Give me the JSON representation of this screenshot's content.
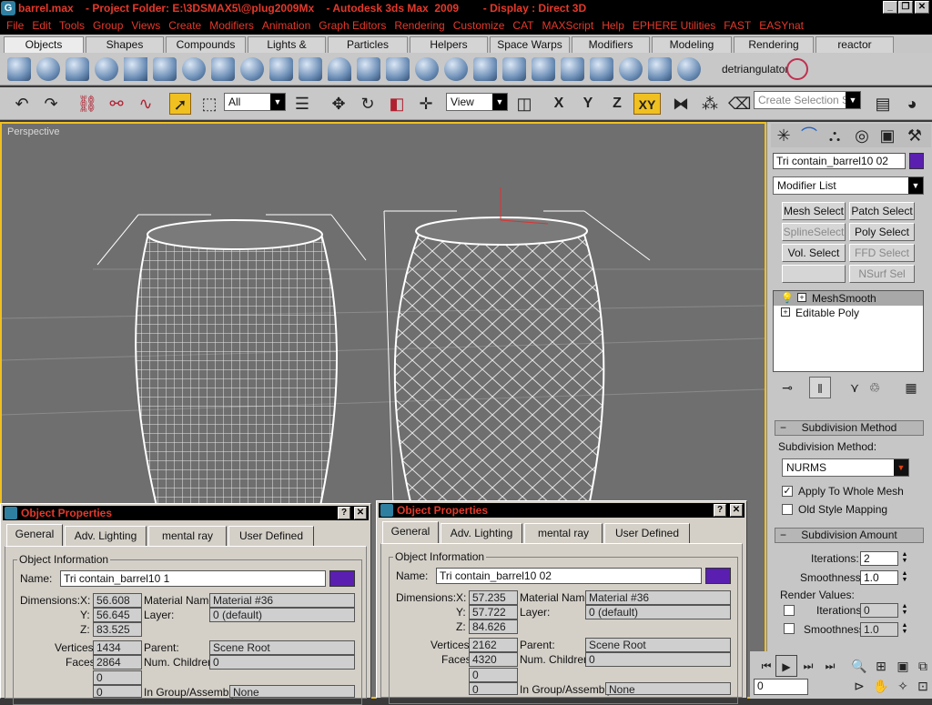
{
  "title_bar": {
    "text": "barrel.max    - Project Folder: E:\\3DSMAX5\\@plug2009Mx    - Autodesk 3ds Max  2009        - Display : Direct 3D",
    "app_icon": "3ds-max-icon"
  },
  "menu": [
    "File",
    "Edit",
    "Tools",
    "Group",
    "Views",
    "Create",
    "Modifiers",
    "Animation",
    "Graph Editors",
    "Rendering",
    "Customize",
    "CAT",
    "MAXScript",
    "Help",
    "EPHERE Utilities",
    "FAST",
    "EASYnat"
  ],
  "tabs": [
    "Objects",
    "Shapes",
    "Compounds",
    "Lights & Cameras",
    "Particles",
    "Helpers",
    "Space Warps",
    "Modifiers",
    "Modeling",
    "Rendering",
    "reactor"
  ],
  "active_tab": "Objects",
  "create_toolbar": {
    "detriangulator_label": "detriangulator"
  },
  "main_toolbar": {
    "selection_filter": "All",
    "ref_coord": "View",
    "axis_x": "X",
    "axis_y": "Y",
    "axis_z": "Z",
    "axis_xy": "XY",
    "named_selection_placeholder": "Create Selection Set"
  },
  "viewport": {
    "label": "Perspective"
  },
  "command_panel": {
    "object_name": "Tri contain_barrel10 02",
    "object_color": "#5a1fb0",
    "modifier_list": "Modifier List",
    "mod_buttons": [
      {
        "label": "Mesh Select",
        "enabled": true
      },
      {
        "label": "Patch Select",
        "enabled": true
      },
      {
        "label": "SplineSelect",
        "enabled": false
      },
      {
        "label": "Poly Select",
        "enabled": true
      },
      {
        "label": "Vol. Select",
        "enabled": true
      },
      {
        "label": "FFD Select",
        "enabled": false
      },
      {
        "label": "",
        "enabled": false
      },
      {
        "label": "NSurf Sel",
        "enabled": false
      }
    ],
    "stack": [
      {
        "label": "MeshSmooth",
        "selected": true
      },
      {
        "label": "Editable Poly",
        "selected": false
      }
    ],
    "subdivision_method": {
      "header": "Subdivision Method",
      "label": "Subdivision Method:",
      "value": "NURMS",
      "apply_whole_mesh": "Apply To Whole Mesh",
      "apply_whole_mesh_checked": true,
      "old_style_mapping": "Old Style Mapping",
      "old_style_mapping_checked": false
    },
    "subdivision_amount": {
      "header": "Subdivision Amount",
      "iterations_label": "Iterations:",
      "iterations": "2",
      "smoothness_label": "Smoothness:",
      "smoothness": "1.0",
      "render_values_label": "Render Values:",
      "render_iterations_label": "Iterations:",
      "render_iterations": "0",
      "render_smoothness_label": "Smoothness:",
      "render_smoothness": "1.0"
    }
  },
  "time_field": "0",
  "dialog_left": {
    "title": "Object Properties",
    "tabs": [
      "General",
      "Adv. Lighting",
      "mental ray",
      "User Defined"
    ],
    "group_title": "Object Information",
    "name_label": "Name:",
    "name": "Tri contain_barrel10 1",
    "color": "#5a1fb0",
    "dimensions_label": "Dimensions:",
    "x": "56.608",
    "y": "56.645",
    "z": "83.525",
    "material_name_label": "Material Name:",
    "material_name": "Material #36",
    "layer_label": "Layer:",
    "layer": "0 (default)",
    "vertices_label": "Vertices:",
    "vertices": "1434",
    "faces_label": "Faces:",
    "faces": "2864",
    "parent_label": "Parent:",
    "parent": "Scene Root",
    "children_label": "Num. Children:",
    "children": "0",
    "blank1": "0",
    "blank2": "0",
    "group_label": "In Group/Assembly:",
    "group": "None"
  },
  "dialog_right": {
    "title": "Object Properties",
    "tabs": [
      "General",
      "Adv. Lighting",
      "mental ray",
      "User Defined"
    ],
    "group_title": "Object Information",
    "name_label": "Name:",
    "name": "Tri contain_barrel10 02",
    "color": "#5a1fb0",
    "dimensions_label": "Dimensions:",
    "x": "57.235",
    "y": "57.722",
    "z": "84.626",
    "material_name_label": "Material Name:",
    "material_name": "Material #36",
    "layer_label": "Layer:",
    "layer": "0 (default)",
    "vertices_label": "Vertices:",
    "vertices": "2162",
    "faces_label": "Faces:",
    "faces": "4320",
    "parent_label": "Parent:",
    "parent": "Scene Root",
    "children_label": "Num. Children:",
    "children": "0",
    "blank1": "0",
    "blank2": "0",
    "group_label": "In Group/Assembly:",
    "group": "None"
  }
}
